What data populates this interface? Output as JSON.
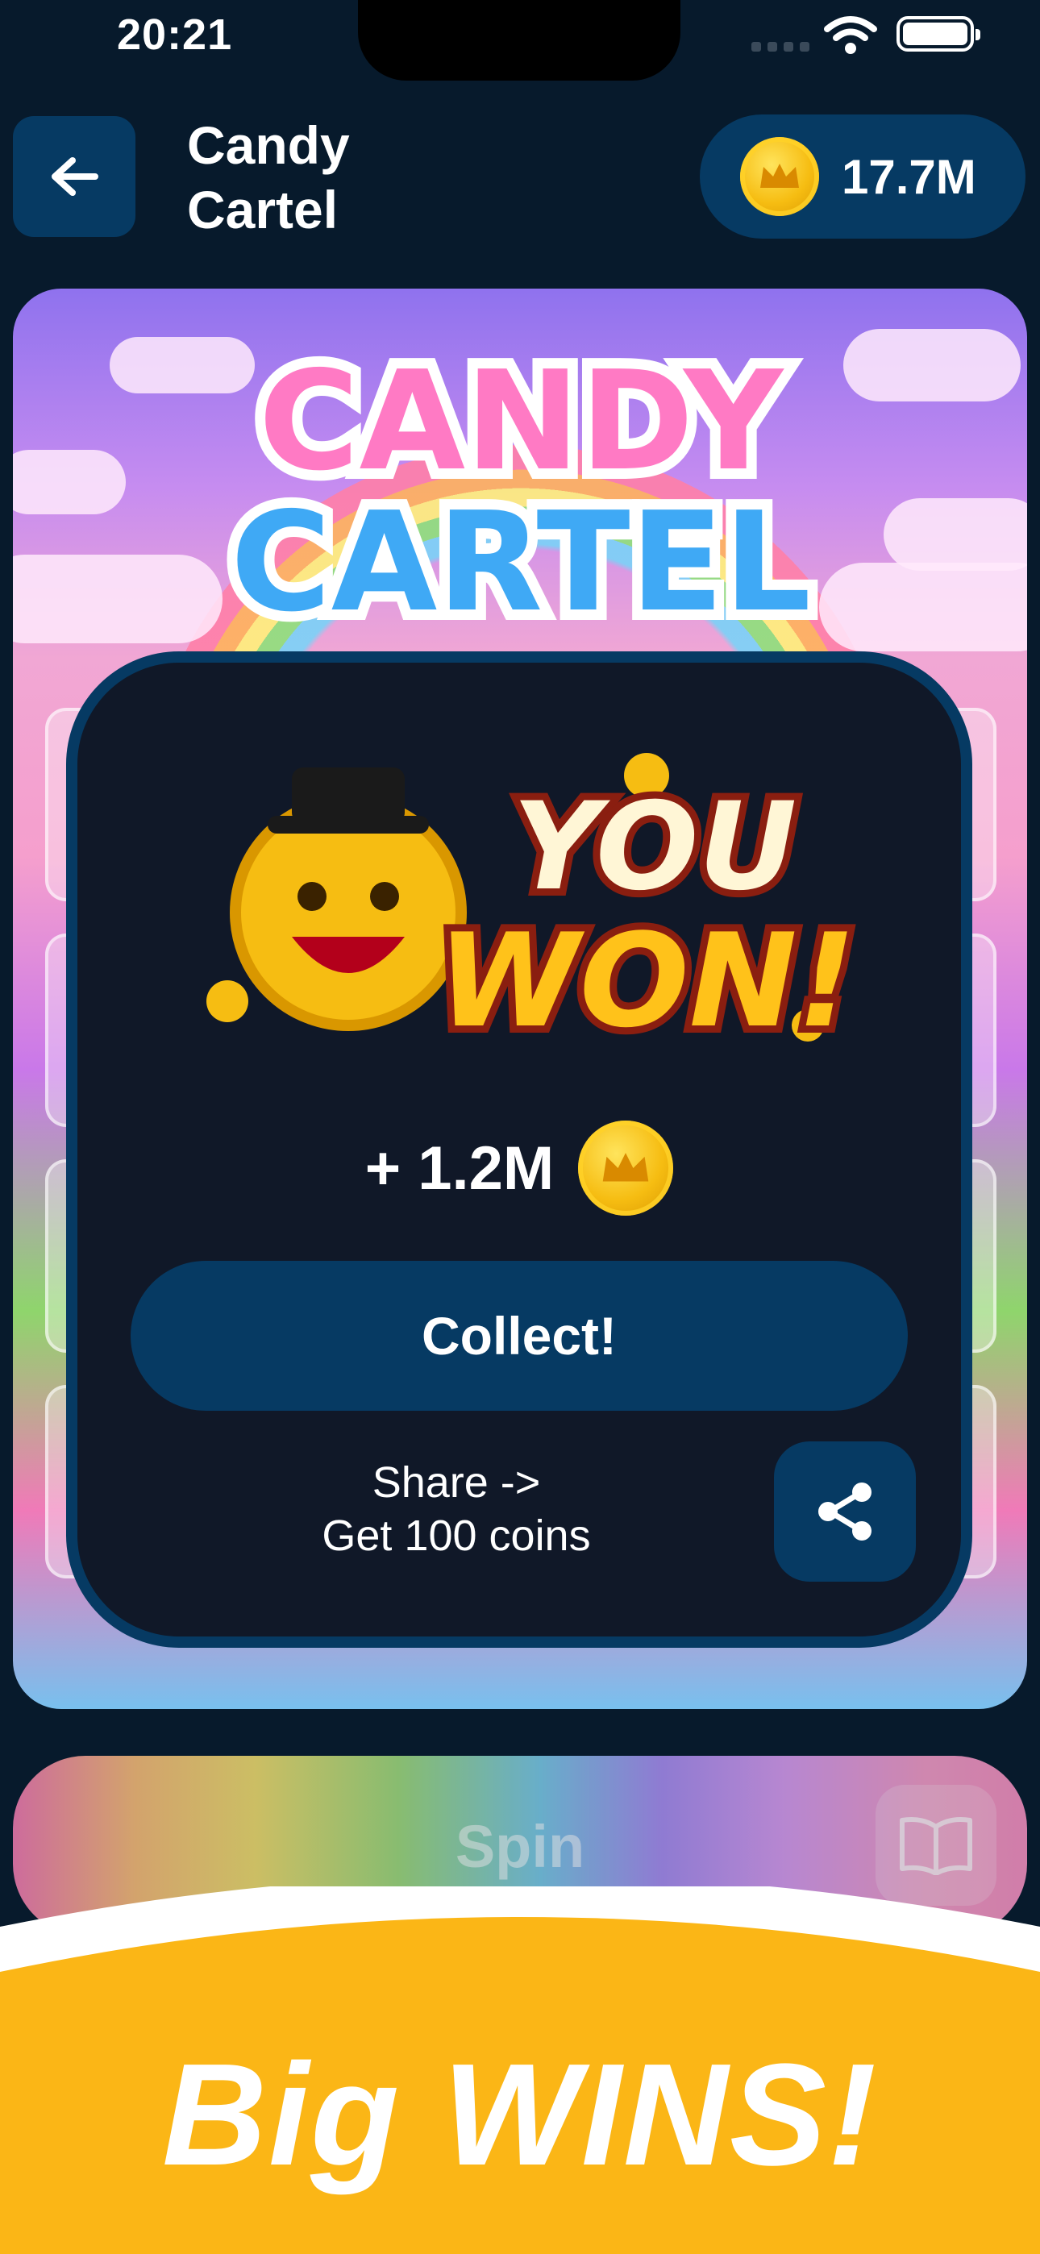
{
  "status_bar": {
    "time": "20:21"
  },
  "header": {
    "title": "Candy Cartel",
    "title_line1": "Candy",
    "title_line2": "Cartel",
    "balance": "17.7M"
  },
  "game": {
    "logo_line1": "CANDY",
    "logo_line2": "CARTEL"
  },
  "win_modal": {
    "art_line1": "YOU",
    "art_line2": "WON!",
    "amount": "+ 1.2M",
    "collect_label": "Collect!",
    "share_line1": "Share ->",
    "share_line2": "Get 100 coins"
  },
  "spin": {
    "label": "Spin"
  },
  "promo": {
    "text": "Big WINS!"
  },
  "colors": {
    "background": "#071a2c",
    "accent": "#063a63",
    "modal": "#101828",
    "coin": "#f6bd12",
    "promo": "#fbb616"
  },
  "icons": [
    "back-arrow-icon",
    "crown-coin-icon",
    "share-icon",
    "book-icon",
    "wifi-icon",
    "battery-icon",
    "signal-icon"
  ]
}
